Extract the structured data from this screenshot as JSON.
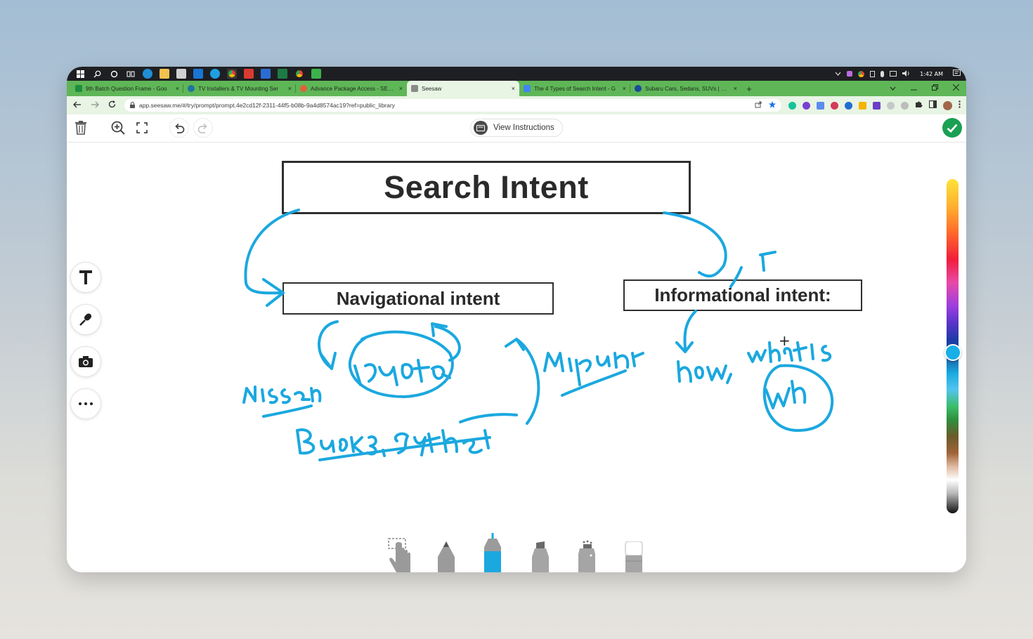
{
  "taskbar": {
    "time": "1:42 AM"
  },
  "tabs": [
    {
      "label": "9th Batch Question Frame - Goo",
      "close": "×",
      "favicon_color": "#1e8e3e"
    },
    {
      "label": "TV Installers & TV Mounting Ser",
      "close": "×",
      "favicon_color": "#21759b"
    },
    {
      "label": "Advance Package Access - SEO T",
      "close": "×",
      "favicon_color": "#e0623a"
    },
    {
      "label": "Seesaw",
      "close": "×",
      "favicon_color": "#8a8a8a"
    },
    {
      "label": "The 4 Types of Search Intent - G",
      "close": "×",
      "favicon_color": "#4285f4"
    },
    {
      "label": "Subaru Cars, Sedans, SUVs | Sub",
      "close": "×",
      "favicon_color": "#1a4b9b"
    }
  ],
  "new_tab": "+",
  "address_bar": {
    "url": "app.seesaw.me/#/try/prompt/prompt.4e2cd12f-2311-44f5-b08b-9a4d8574ac19?ref=public_library"
  },
  "toolbar": {
    "view_instructions": "View Instructions"
  },
  "canvas": {
    "title": "Search Intent",
    "nav_box": "Navigational intent",
    "info_box": "Informational intent:"
  },
  "colors": {
    "browser_tabstrip": "#5fb657",
    "browser_toolbar": "#e8f4e4",
    "ink": "#1ba8df",
    "done_green": "#1aa052",
    "box_border": "#2f2f2f"
  },
  "icons": {
    "trash": "trash-icon",
    "zoom_in": "zoom-in-icon",
    "fullscreen": "fullscreen-icon",
    "undo": "undo-icon",
    "redo": "redo-icon",
    "done": "checkmark-icon",
    "text_tool": "text-tool-icon",
    "mic_tool": "microphone-icon",
    "camera_tool": "camera-icon",
    "more": "more-icon",
    "quote": "quote-icon"
  },
  "selected_color": "cyan blue",
  "selected_tool": "marker"
}
